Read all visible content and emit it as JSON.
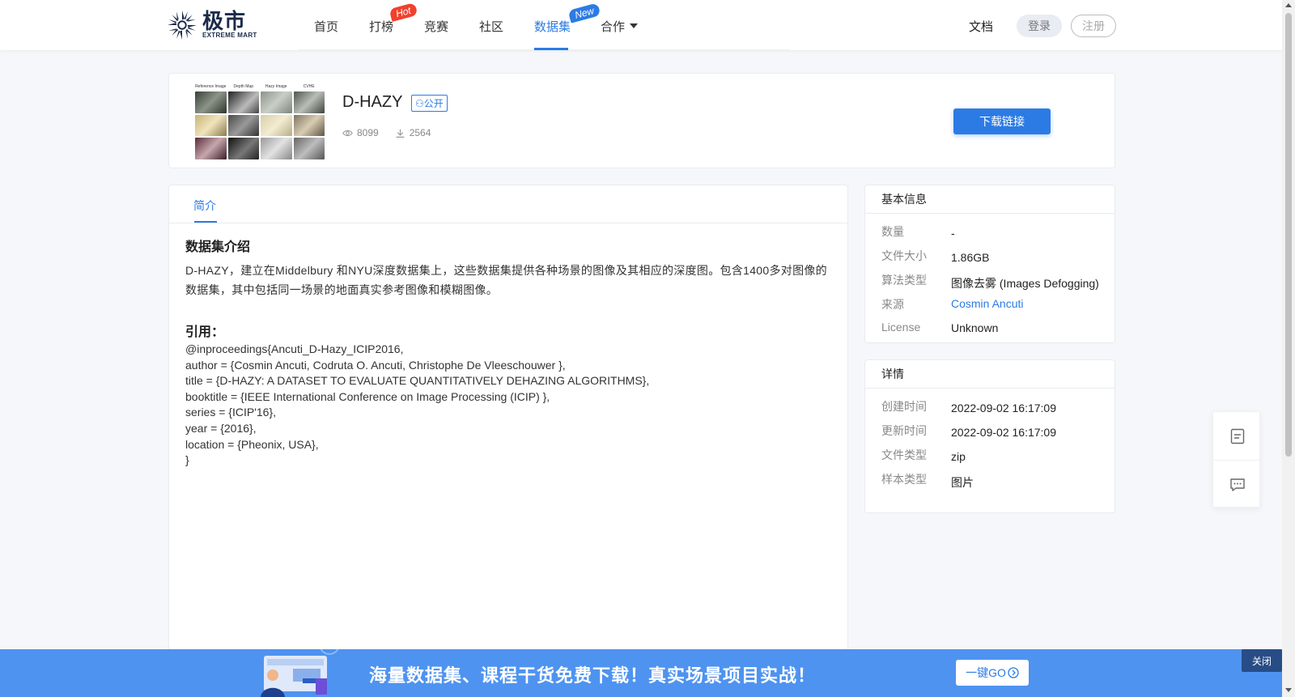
{
  "header": {
    "logo_cn": "极市",
    "logo_en": "EXTREME MART",
    "nav": [
      {
        "label": "首页"
      },
      {
        "label": "打榜",
        "badge": "Hot"
      },
      {
        "label": "竞赛"
      },
      {
        "label": "社区"
      },
      {
        "label": "数据集",
        "badge": "New",
        "active": true
      },
      {
        "label": "合作"
      }
    ],
    "docs_label": "文档",
    "login_label": "登录",
    "register_label": "注册"
  },
  "dataset": {
    "thumbnail_captions": [
      "Reference Image",
      "Depth Map",
      "Hazy Image",
      "CVHE"
    ],
    "title": "D-HAZY",
    "visibility": "公开",
    "views": "8099",
    "downloads": "2564",
    "download_label": "下载链接"
  },
  "main": {
    "tab_label": "简介",
    "intro_title": "数据集介绍",
    "intro_text": "D-HAZY，建立在Middelbury 和NYU深度数据集上，这些数据集提供各种场景的图像及其相应的深度图。包含1400多对图像的数据集，其中包括同一场景的地面真实参考图像和模糊图像。",
    "citation_title": "引用：",
    "citation_lines": [
      "@inproceedings{Ancuti_D-Hazy_ICIP2016,",
      "author = {Cosmin Ancuti, Codruta O. Ancuti, Christophe De Vleeschouwer },",
      "title = {D-HAZY: A DATASET TO EVALUATE QUANTITATIVELY DEHAZING ALGORITHMS},",
      "booktitle = {IEEE International Conference on Image Processing (ICIP) },",
      "series = {ICIP'16},",
      "year = {2016},",
      "location = {Pheonix, USA},",
      "}"
    ]
  },
  "basic_info": {
    "title": "基本信息",
    "rows": [
      {
        "key": "数量",
        "value": "-"
      },
      {
        "key": "文件大小",
        "value": "1.86GB"
      },
      {
        "key": "算法类型",
        "value": "图像去雾 (Images Defogging)"
      },
      {
        "key": "来源",
        "value": "Cosmin Ancuti"
      },
      {
        "key": "License",
        "value": "Unknown"
      }
    ]
  },
  "details": {
    "title": "详情",
    "rows": [
      {
        "key": "创建时间",
        "value": "2022-09-02 16:17:09"
      },
      {
        "key": "更新时间",
        "value": "2022-09-02 16:17:09"
      },
      {
        "key": "文件类型",
        "value": "zip"
      },
      {
        "key": "样本类型",
        "value": "图片"
      }
    ]
  },
  "banner": {
    "text": "海量数据集、课程干货免费下载！真实场景项目实战！",
    "go_label": "一键GO",
    "close_label": "关闭"
  },
  "colors": {
    "accent": "#2c7be5",
    "hot_badge": "#f0412c",
    "banner": "#4e93f0"
  }
}
